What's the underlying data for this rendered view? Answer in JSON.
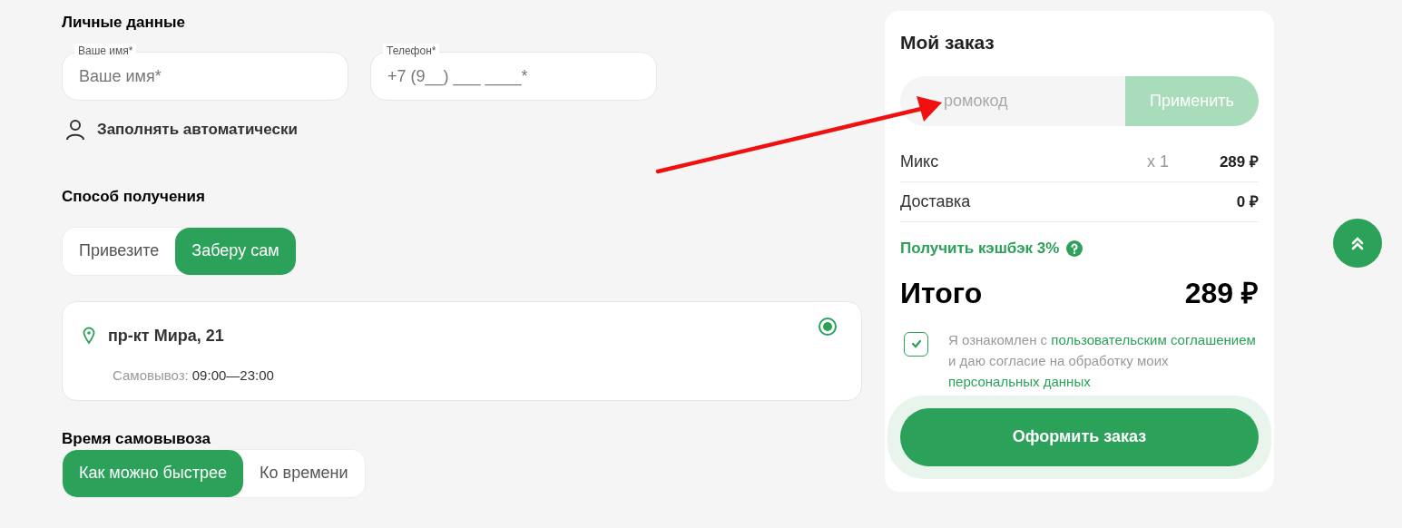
{
  "personal": {
    "title": "Личные данные",
    "fields": [
      {
        "label": "Ваше имя*",
        "placeholder": "Ваше имя*"
      },
      {
        "label": "Телефон*",
        "placeholder": "+7 (9__) ___ ____*"
      }
    ],
    "autofill": "Заполнять автоматически"
  },
  "delivery": {
    "title": "Способ получения",
    "options": [
      {
        "label": "Привезите",
        "selected": false
      },
      {
        "label": "Заберу сам",
        "selected": true
      }
    ],
    "pickup_points": [
      {
        "address": "пр-кт Мира, 21",
        "hours_label": "Самовывоз:",
        "hours": "09:00—23:00",
        "selected": true
      }
    ]
  },
  "pickup_time": {
    "title": "Время самовывоза",
    "options": [
      {
        "label": "Как можно быстрее",
        "selected": true
      },
      {
        "label": "Ко времени",
        "selected": false
      }
    ]
  },
  "order": {
    "title": "Мой заказ",
    "promo": {
      "placeholder": "ромокод",
      "button": "Применить",
      "disabled": true
    },
    "items": [
      {
        "name": "Микс",
        "qty": "x 1",
        "price": "289 ₽"
      },
      {
        "name": "Доставка",
        "price": "0 ₽"
      }
    ],
    "cashback": "Получить кэшбэк 3%",
    "total_label": "Итого",
    "total": "289 ₽",
    "consent": {
      "checked": true,
      "parts": [
        {
          "text": "Я ознакомлен с ",
          "kind": "text"
        },
        {
          "text": "пользовательским соглашением",
          "kind": "link"
        },
        {
          "text": " и даю согласие на обработку моих ",
          "kind": "text"
        },
        {
          "text": "персональных данных",
          "kind": "link"
        }
      ]
    },
    "submit": "Оформить заказ"
  }
}
